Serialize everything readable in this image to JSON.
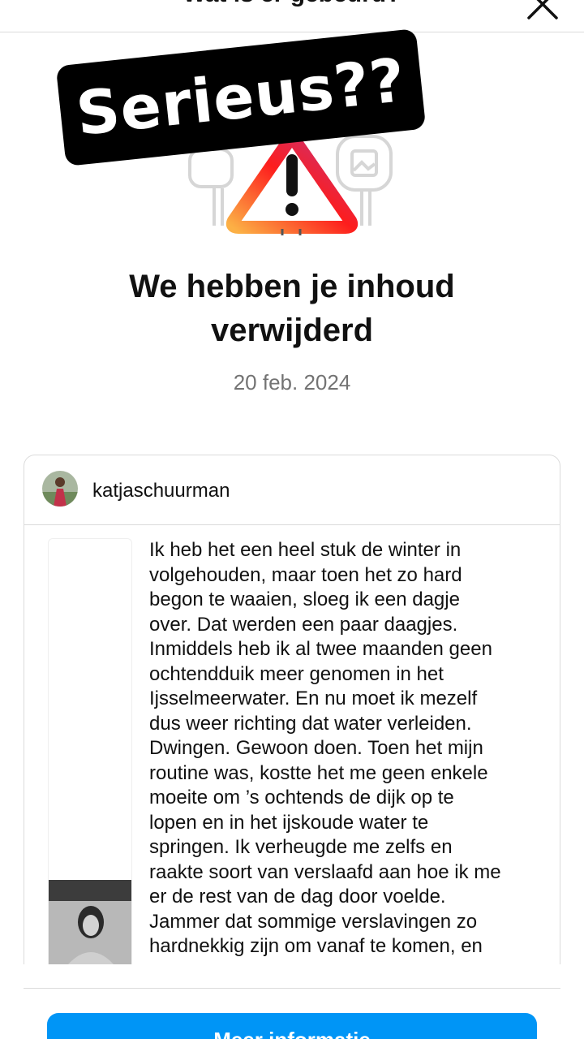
{
  "header": {
    "title": "Wat is er gebeurd?",
    "close_icon": "close-icon"
  },
  "sticker": {
    "text": "Serieus??"
  },
  "illustration": {
    "icon": "warning-triangle-icon",
    "side_icons": [
      "chat-bubble-icon",
      "image-icon"
    ]
  },
  "main": {
    "headline": "We hebben je inhoud verwijderd",
    "date": "20 feb. 2024"
  },
  "post": {
    "username": "katjaschuurman",
    "text": "Ik heb het een heel stuk de winter in\nvolgehouden, maar toen het zo hard\nbegon te waaien, sloeg ik een dagje\nover. Dat werden een paar daagjes.\nInmiddels heb ik al twee maanden geen\nochtendduik meer genomen in het\nIjsselmeerwater. En nu moet ik mezelf\ndus weer richting dat water verleiden.\nDwingen. Gewoon doen.  Toen het mijn\nroutine was, kostte het me geen enkele\nmoeite om ’s ochtends de dijk op te\nlopen en in het ijskoude water te\nspringen. Ik verheugde me zelfs en\nraakte soort van verslaafd aan hoe ik me\ner de rest van de dag door voelde.\nJammer dat sommige verslavingen zo\nhardnekkig zijn om vanaf te komen, en"
  },
  "footer": {
    "button_label": "Meer informatie"
  },
  "colors": {
    "accent": "#0095f6",
    "border": "#dbdbdb",
    "muted_text": "#737373",
    "warning_gradient": [
      "#fcb045",
      "#fd1d1d",
      "#c13584"
    ]
  }
}
